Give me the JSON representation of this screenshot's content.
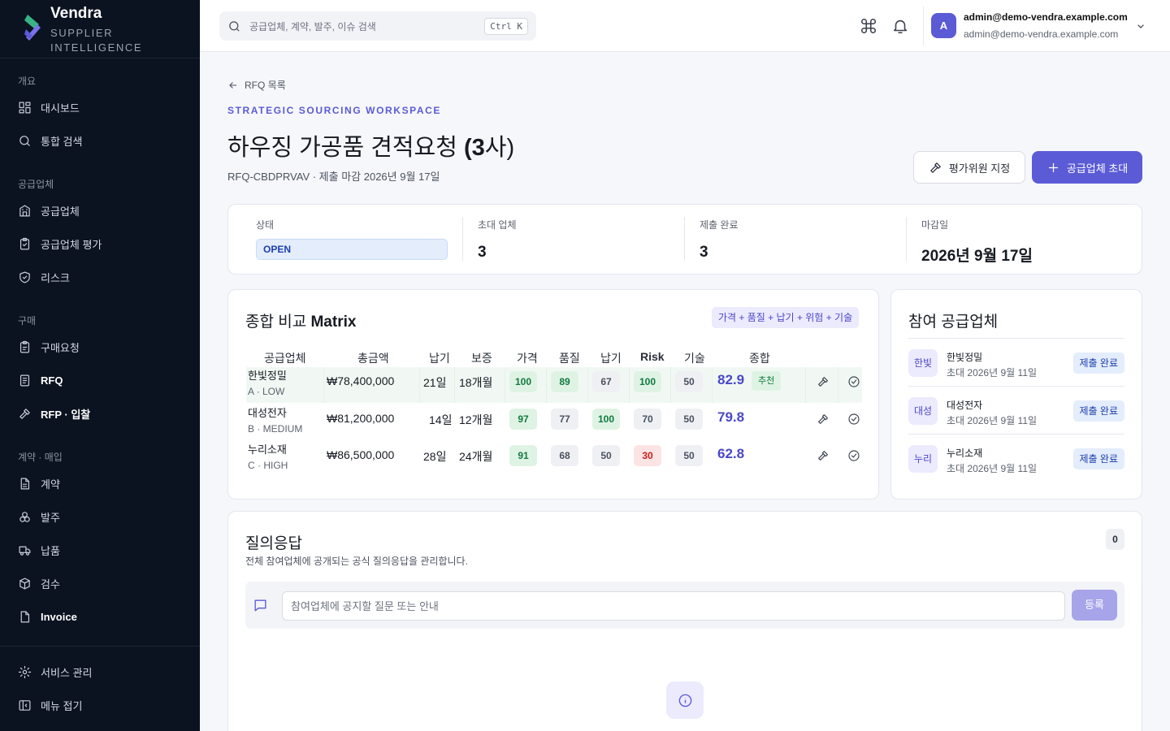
{
  "brand": {
    "name": "Vendra",
    "sub1": "SUPPLIER",
    "sub2": "INTELLIGENCE"
  },
  "sidebar": {
    "groups": [
      {
        "title": "개요",
        "items": [
          {
            "label": "대시보드",
            "icon": "grid-icon"
          },
          {
            "label": "통합 검색",
            "icon": "search-icon"
          }
        ]
      },
      {
        "title": "공급업체",
        "items": [
          {
            "label": "공급업체",
            "icon": "building-icon"
          },
          {
            "label": "공급업체 평가",
            "icon": "clipboard-check-icon"
          },
          {
            "label": "리스크",
            "icon": "shield-icon"
          }
        ]
      },
      {
        "title": "구매",
        "items": [
          {
            "label": "구매요청",
            "icon": "clipboard-icon"
          },
          {
            "label": "RFQ",
            "icon": "file-list-icon"
          },
          {
            "label": "RFP · 입찰",
            "icon": "gavel-icon"
          }
        ]
      },
      {
        "title": "계약 · 매입",
        "items": [
          {
            "label": "계약",
            "icon": "document-icon"
          },
          {
            "label": "발주",
            "icon": "boxes-icon"
          },
          {
            "label": "납품",
            "icon": "truck-icon"
          },
          {
            "label": "검수",
            "icon": "package-check-icon"
          },
          {
            "label": "Invoice",
            "icon": "invoice-icon"
          }
        ]
      }
    ],
    "bottom": [
      {
        "label": "서비스 관리",
        "icon": "gear-icon"
      },
      {
        "label": "메뉴 접기",
        "icon": "collapse-icon"
      }
    ]
  },
  "topbar": {
    "search_placeholder": "공급업체, 계약, 발주, 이슈 검색",
    "shortcut": "Ctrl K",
    "avatar": "A",
    "user_name": "admin@demo-vendra.example.com",
    "user_email": "admin@demo-vendra.example.com"
  },
  "page": {
    "back": "RFQ 목록",
    "eyebrow": "STRATEGIC SOURCING WORKSPACE",
    "title_main": "하우징 가공품 견적요청 ",
    "title_count": "(3",
    "title_suffix": "사)",
    "meta": "RFQ-CBDPRVAV · 제출 마감 2026년 9월 17일",
    "btn_assign": "평가위원 지정",
    "btn_invite": "공급업체 초대"
  },
  "stats": {
    "status_label": "상태",
    "status_value": "OPEN",
    "invited_label": "초대 업체",
    "invited_value": "3",
    "submitted_label": "제출 완료",
    "submitted_value": "3",
    "deadline_label": "마감일",
    "deadline_value": "2026년 9월 17일"
  },
  "matrix": {
    "title_a": "종합 비교 ",
    "title_b": "Matrix",
    "formula": "가격 + 품질 + 납기 + 위험 + 기술",
    "headers": {
      "supplier": "공급업체",
      "total_amount": "총금액",
      "leadtime": "납기",
      "warranty": "보증",
      "price": "가격",
      "quality": "품질",
      "delivery": "납기",
      "risk": "Risk",
      "tech": "기술",
      "overall": "종합"
    },
    "rows": [
      {
        "name": "한빛정밀",
        "sub": "A · LOW",
        "amount": "₩78,400,000",
        "leadtime": "21일",
        "warranty": "18개월",
        "price": "100",
        "quality": "89",
        "delivery": "67",
        "risk": "100",
        "tech": "50",
        "total": "82.9",
        "rec": "추천"
      },
      {
        "name": "대성전자",
        "sub": "B · MEDIUM",
        "amount": "₩81,200,000",
        "leadtime": "14일",
        "warranty": "12개월",
        "price": "97",
        "quality": "77",
        "delivery": "100",
        "risk": "70",
        "tech": "50",
        "total": "79.8"
      },
      {
        "name": "누리소재",
        "sub": "C · HIGH",
        "amount": "₩86,500,000",
        "leadtime": "28일",
        "warranty": "24개월",
        "price": "91",
        "quality": "68",
        "delivery": "50",
        "risk": "30",
        "tech": "50",
        "total": "62.8"
      }
    ]
  },
  "suppliers": {
    "title": "참여 공급업체",
    "items": [
      {
        "abbr": "한빛",
        "name": "한빛정밀",
        "invited": "초대 2026년 9월 11일",
        "status": "제출 완료"
      },
      {
        "abbr": "대성",
        "name": "대성전자",
        "invited": "초대 2026년 9월 11일",
        "status": "제출 완료"
      },
      {
        "abbr": "누리",
        "name": "누리소재",
        "invited": "초대 2026년 9월 11일",
        "status": "제출 완료"
      }
    ]
  },
  "qa": {
    "title": "질의응답",
    "count": "0",
    "subtitle": "전체 참여업체에 공개되는 공식 질의응답을 관리합니다.",
    "placeholder": "참여업체에 공지할 질문 또는 안내",
    "submit": "등록"
  },
  "colors": {
    "accent": "#5b5bd6",
    "sidebar_bg": "#0b1220",
    "good": "#107a3e",
    "bad": "#c81e1e"
  }
}
